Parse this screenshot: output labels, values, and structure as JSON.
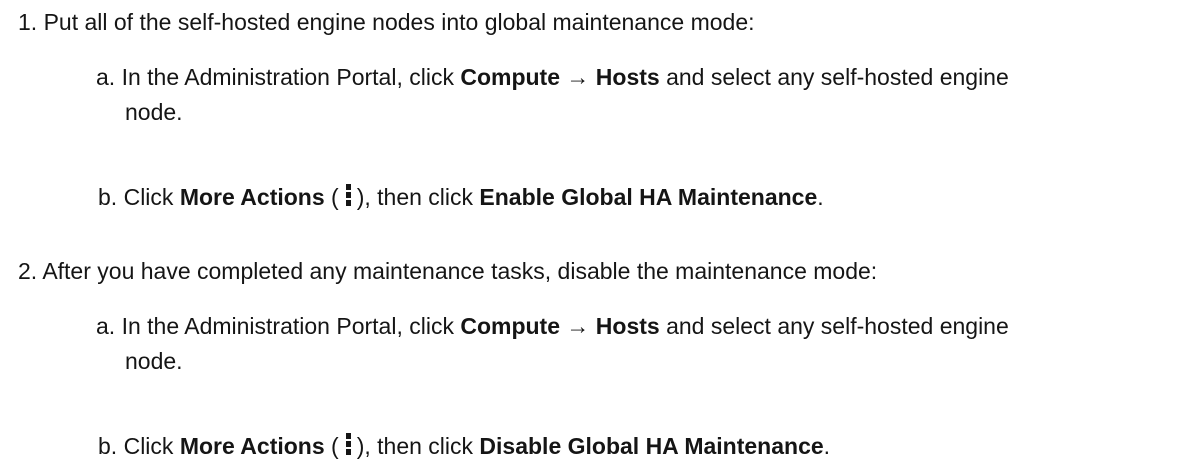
{
  "steps": [
    {
      "number": "1.",
      "text": "Put all of the self-hosted engine nodes into global maintenance mode:",
      "substeps": [
        {
          "letter": "a.",
          "text_before": "In the Administration Portal, click ",
          "menu_compute": "Compute",
          "arrow": "→",
          "menu_hosts": "Hosts",
          "text_after": " and select any self-hosted engine",
          "continuation": "node."
        },
        {
          "letter": "b.",
          "text_before": "Click ",
          "more_actions": "More Actions",
          "paren_open": " (",
          "paren_close": "), then click ",
          "action": "Enable Global HA Maintenance",
          "period": "."
        }
      ]
    },
    {
      "number": "2.",
      "text": "After you have completed any maintenance tasks, disable the maintenance mode:",
      "substeps": [
        {
          "letter": "a.",
          "text_before": "In the Administration Portal, click ",
          "menu_compute": "Compute",
          "arrow": "→",
          "menu_hosts": "Hosts",
          "text_after": " and select any self-hosted engine",
          "continuation": "node."
        },
        {
          "letter": "b.",
          "text_before": "Click ",
          "more_actions": "More Actions",
          "paren_open": " (",
          "paren_close": "), then click ",
          "action": "Disable Global HA Maintenance",
          "period": "."
        }
      ]
    }
  ],
  "icons": {
    "more_actions_icon": "kebab-vertical-icon"
  }
}
